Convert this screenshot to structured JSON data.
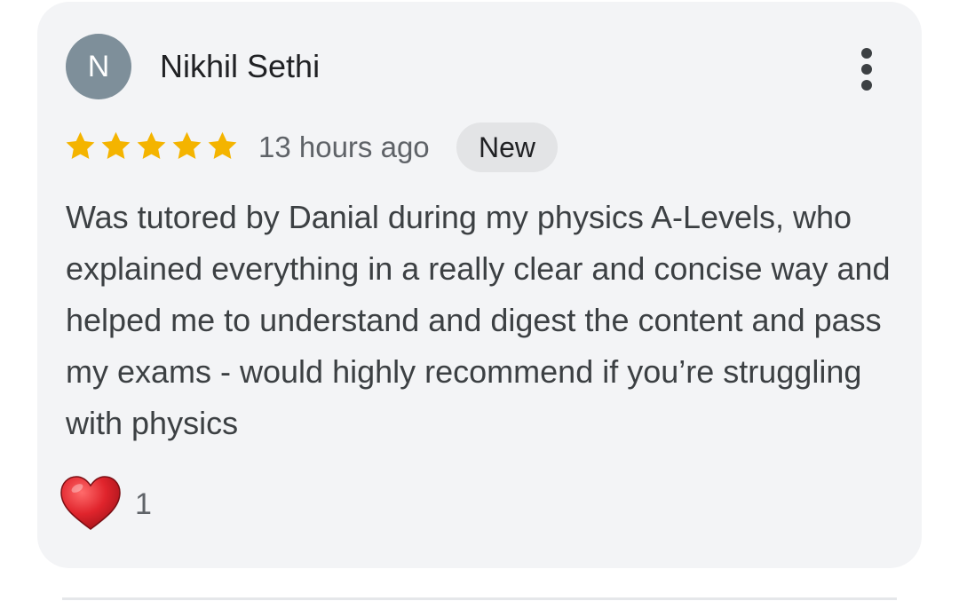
{
  "review": {
    "avatar_initial": "N",
    "reviewer_name": "Nikhil Sethi",
    "rating": 5,
    "rating_max": 5,
    "timestamp": "13 hours ago",
    "badge": "New",
    "text": "Was tutored by Danial during my physics A-Levels, who explained everything in a really clear and concise way and helped me to understand and digest the content and pass my exams - would highly recommend if you’re struggling with physics",
    "reaction_icon": "heart-icon",
    "reaction_count": "1"
  },
  "colors": {
    "avatar_bg": "#7e8f9a",
    "star": "#f4b400",
    "card_bg": "#f3f4f6",
    "badge_bg": "#e3e4e6",
    "heart": "#e0242c"
  }
}
